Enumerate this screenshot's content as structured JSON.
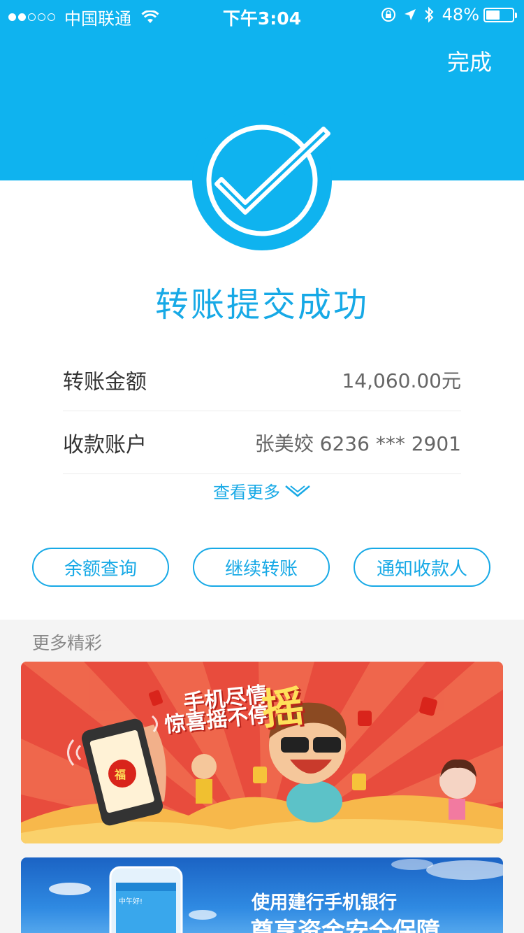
{
  "status_bar": {
    "carrier": "中国联通",
    "time": "下午3:04",
    "battery": "48%"
  },
  "header": {
    "done_label": "完成"
  },
  "result": {
    "title": "转账提交成功"
  },
  "details": [
    {
      "label": "转账金额",
      "value": "14,060.00元"
    },
    {
      "label": "收款账户",
      "value": "张美姣 6236 *** 2901"
    }
  ],
  "more_link": "查看更多",
  "actions": {
    "balance": "余额查询",
    "continue": "继续转账",
    "notify": "通知收款人"
  },
  "more_section": {
    "title": "更多精彩",
    "banner1": {
      "line1": "手机尽情",
      "line2": "惊喜摇不停",
      "big": "摇",
      "envelope": "福"
    },
    "banner2": {
      "line1": "使用建行手机银行",
      "line2": "尊享资金安全保障",
      "phone_text": "中午好!"
    }
  },
  "colors": {
    "accent": "#0fb3ef",
    "text_blue": "#17a9e6",
    "banner_red": "#e84c3d"
  }
}
